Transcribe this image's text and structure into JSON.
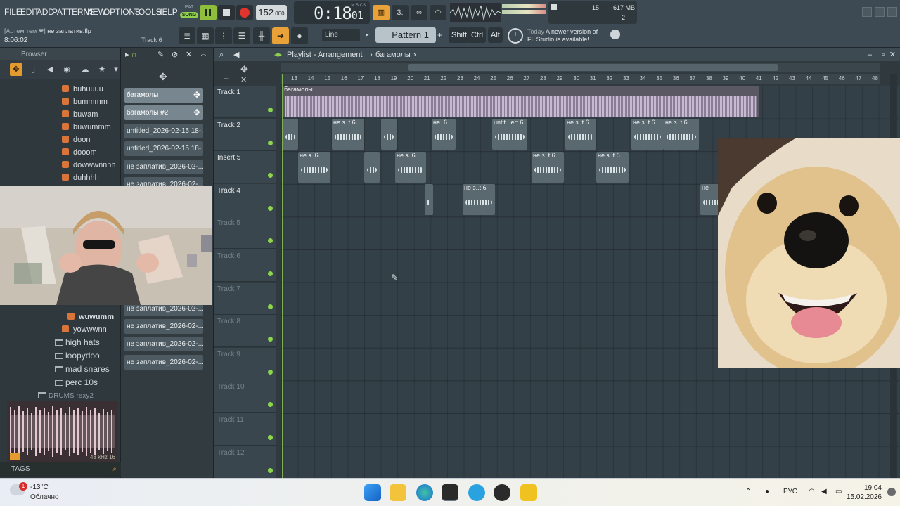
{
  "menu": [
    "FILE",
    "EDIT",
    "ADD",
    "PATTERNS",
    "VIEW",
    "OPTIONS",
    "TOOLS",
    "HELP"
  ],
  "transport": {
    "pat_label": "PAT",
    "song_label": "SONG",
    "tempo": "152",
    "tempo_frac": ".000",
    "time": "0:18",
    "time_frac": "01",
    "msc_label": "M:S:CS"
  },
  "cpu": {
    "memory": "617 MB",
    "value_top": "15",
    "value_bottom": "2"
  },
  "project": {
    "user": "[Артем тем ❤]",
    "file": "не заплатив.flp",
    "elapsed": "8:06:02",
    "selected_track": "Track 6"
  },
  "toolbar2": {
    "snap": "Line",
    "pattern": "Pattern 1",
    "keys": [
      "Shift",
      "Ctrl",
      "Alt"
    ]
  },
  "news": {
    "today": "Today",
    "line1": "A newer version of",
    "line2": "FL Studio is available!"
  },
  "browser": {
    "title": "Browser",
    "files_top": [
      "buhuuuu",
      "bummmm",
      "buwam",
      "buwummm",
      "doon",
      "dooom",
      "dowwwnnnn",
      "duhhhh"
    ],
    "files_bottom": [
      "wuwumm",
      "yowwwnn"
    ],
    "folders": [
      "high hats",
      "loopydoo",
      "mad snares",
      "perc 10s",
      "DRUMS rexy2"
    ],
    "preview_rate": "48 kHz 16",
    "tags_label": "TAGS"
  },
  "picker": {
    "items_top": [
      "багамолы",
      "багамолы #2",
      "untitled_2026-02-15 18-...",
      "untitled_2026-02-15 18-...",
      "не заплатив_2026-02-...",
      "не заплатив_2026-02-..."
    ],
    "items_bottom": [
      "не заплатив_2026-02-...",
      "не заплатив_2026-02-...",
      "не заплатив_2026-02-...",
      "не заплатив_2026-02-..."
    ]
  },
  "playlist": {
    "title": "Playlist - Arrangement",
    "crumb": "багамолы",
    "ruler": [
      "13",
      "14",
      "15",
      "16",
      "17",
      "18",
      "19",
      "20",
      "21",
      "22",
      "23",
      "24",
      "25",
      "26",
      "27",
      "28",
      "29",
      "30",
      "31",
      "32",
      "33",
      "34",
      "35",
      "36",
      "37",
      "38",
      "39",
      "40",
      "41",
      "42",
      "43",
      "44",
      "45",
      "46",
      "47",
      "48"
    ],
    "tracks": [
      "Track 1",
      "Track 2",
      "Insert 5",
      "Track 4",
      "Track 5",
      "Track 6",
      "Track 7",
      "Track 8",
      "Track 9",
      "Track 10",
      "Track 11",
      "Track 12"
    ],
    "clips": {
      "big": "багамолы",
      "t2": [
        "не з..t 6",
        "не..6",
        "untit...ert 6",
        "не з..t 6",
        "не з..t 6",
        "не з..t 6"
      ],
      "t3": [
        "не з..6",
        "не з..6",
        "не з..t 6",
        "не з..t 6"
      ],
      "t4": [
        "не з..t 6",
        "не"
      ]
    }
  },
  "taskbar": {
    "badge": "1",
    "temp": "-13°C",
    "weather": "Облачно",
    "lang": "РУС",
    "time": "19:04",
    "date": "15.02.2026"
  },
  "colors": {
    "song": "#8fd14f",
    "accent": "#e9a238",
    "led": "#8bd64b",
    "rec": "#e0342f"
  }
}
